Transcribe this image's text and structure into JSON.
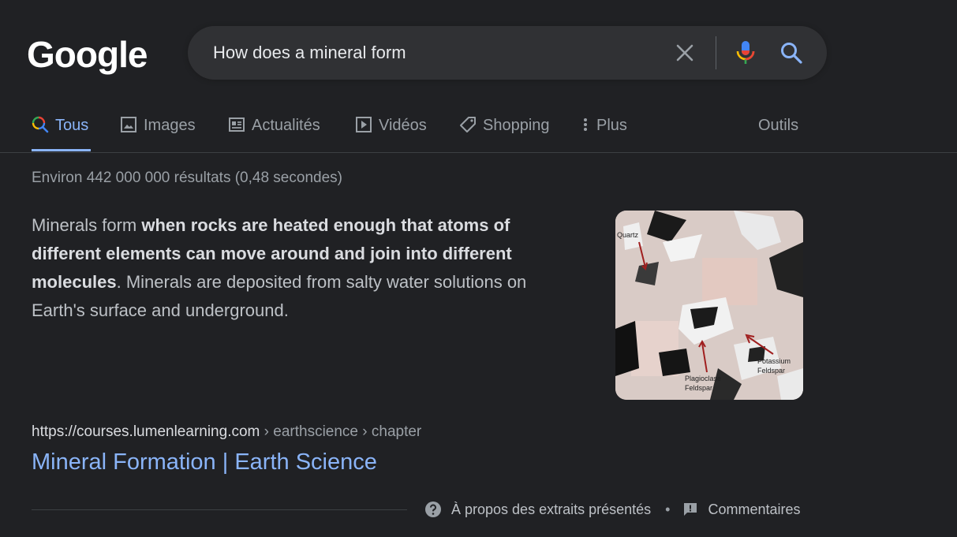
{
  "logo": {
    "text": "Google"
  },
  "search": {
    "query": "How does a mineral form"
  },
  "tabs": [
    {
      "label": "Tous",
      "icon": "search-icon",
      "active": true
    },
    {
      "label": "Images",
      "icon": "image-icon"
    },
    {
      "label": "Actualités",
      "icon": "newspaper-icon"
    },
    {
      "label": "Vidéos",
      "icon": "play-icon"
    },
    {
      "label": "Shopping",
      "icon": "tag-icon"
    },
    {
      "label": "Plus",
      "icon": "more-vert-icon"
    }
  ],
  "tools_label": "Outils",
  "stats": "Environ 442 000 000 résultats (0,48 secondes)",
  "snippet": {
    "pre": "Minerals form ",
    "bold": "when rocks are heated enough that atoms of different elements can move around and join into different molecules",
    "post": ". Minerals are deposited from salty water solutions on Earth's surface and underground."
  },
  "thumbnail": {
    "labels": {
      "quartz": "Quartz",
      "plag1": "Plagioclase",
      "plag2": "Feldspar",
      "pot1": "Potassium",
      "pot2": "Feldspar"
    }
  },
  "result": {
    "domain": "https://courses.lumenlearning.com",
    "path": " › earthscience › chapter",
    "title": "Mineral Formation | Earth Science"
  },
  "footer": {
    "about": "À propos des extraits présentés",
    "separator": "•",
    "feedback": "Commentaires"
  },
  "colors": {
    "background": "#202124",
    "link": "#8ab4f8",
    "text": "#bdc1c6"
  }
}
